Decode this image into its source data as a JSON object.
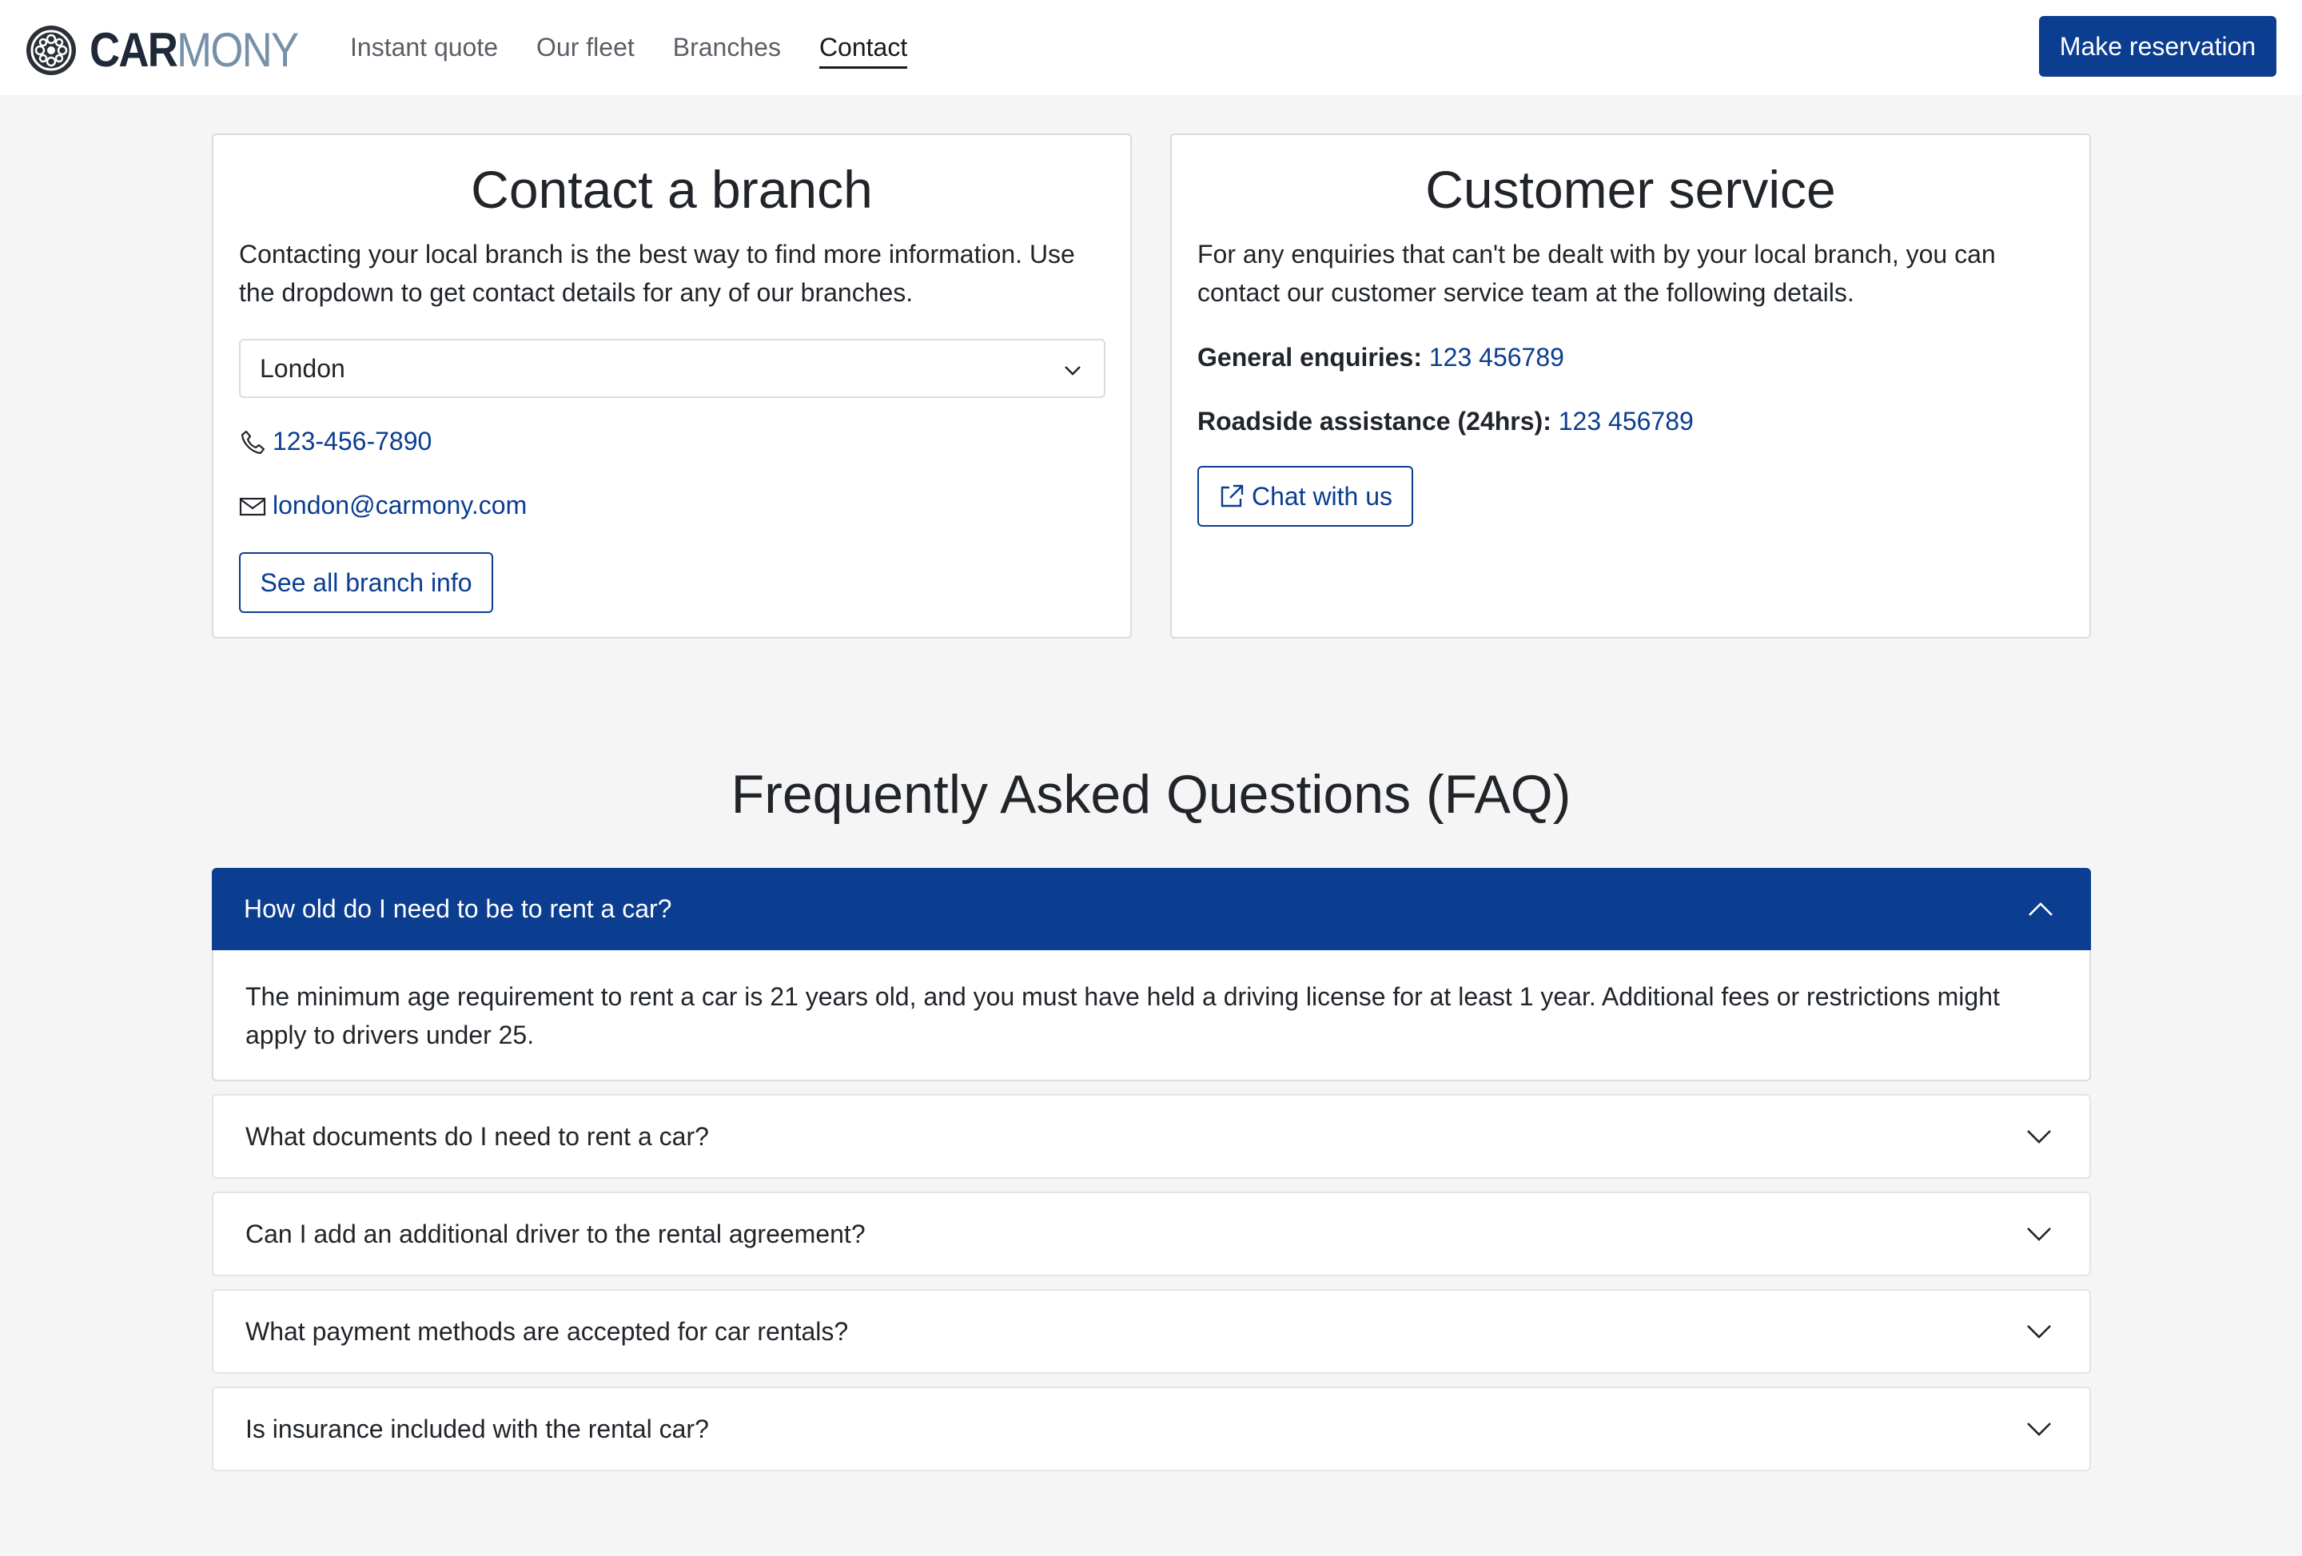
{
  "brand": {
    "part1": "CAR",
    "part2": "MONY"
  },
  "nav": {
    "items": [
      {
        "label": "Instant quote",
        "active": false
      },
      {
        "label": "Our fleet",
        "active": false
      },
      {
        "label": "Branches",
        "active": false
      },
      {
        "label": "Contact",
        "active": true
      }
    ],
    "cta": "Make reservation"
  },
  "branch": {
    "title": "Contact a branch",
    "description": "Contacting your local branch is the best way to find more information. Use the dropdown to get contact details for any of our branches.",
    "selected_branch": "London",
    "phone": "123-456-7890",
    "email": "london@carmony.com",
    "button": "See all branch info"
  },
  "service": {
    "title": "Customer service",
    "description": "For any enquiries that can't be dealt with by your local branch, you can contact our customer service team at the following details.",
    "general_label": "General enquiries:",
    "general_phone": "123 456789",
    "roadside_label": "Roadside assistance (24hrs):",
    "roadside_phone": "123 456789",
    "chat_button": "Chat with us"
  },
  "faq": {
    "title": "Frequently Asked Questions (FAQ)",
    "items": [
      {
        "question": "How old do I need to be to rent a car?",
        "answer": "The minimum age requirement to rent a car is 21 years old, and you must have held a driving license for at least 1 year. Additional fees or restrictions might apply to drivers under 25.",
        "expanded": true
      },
      {
        "question": "What documents do I need to rent a car?",
        "expanded": false
      },
      {
        "question": "Can I add an additional driver to the rental agreement?",
        "expanded": false
      },
      {
        "question": "What payment methods are accepted for car rentals?",
        "expanded": false
      },
      {
        "question": "Is insurance included with the rental car?",
        "expanded": false
      }
    ]
  },
  "colors": {
    "primary": "#0b3d91",
    "background": "#f5f5f5",
    "logo_accent": "#7590a8"
  }
}
